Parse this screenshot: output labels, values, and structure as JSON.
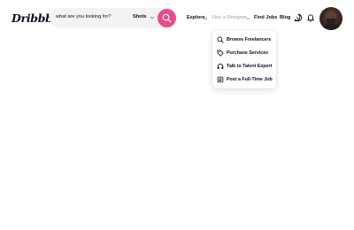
{
  "header": {
    "logo": "Dribbble",
    "search": {
      "placeholder": "what are you looking for?",
      "filter_value": "Shots"
    },
    "nav": {
      "explore": "Explore",
      "hire": "Hire a Designer",
      "find_jobs": "Find Jobs",
      "blog": "Blog"
    }
  },
  "dropdown": {
    "items": [
      {
        "label": "Browse Freelancers",
        "icon": "search-icon"
      },
      {
        "label": "Purchase Services",
        "icon": "tag-icon"
      },
      {
        "label": "Talk to Talent Expert",
        "icon": "headphones-icon"
      },
      {
        "label": "Post a Full-Time Job",
        "icon": "job-post-icon"
      }
    ]
  },
  "colors": {
    "accent": "#ea4c89",
    "text": "#0d0c22",
    "muted": "#9e9ea7",
    "search_bg": "#f3f3f4"
  }
}
